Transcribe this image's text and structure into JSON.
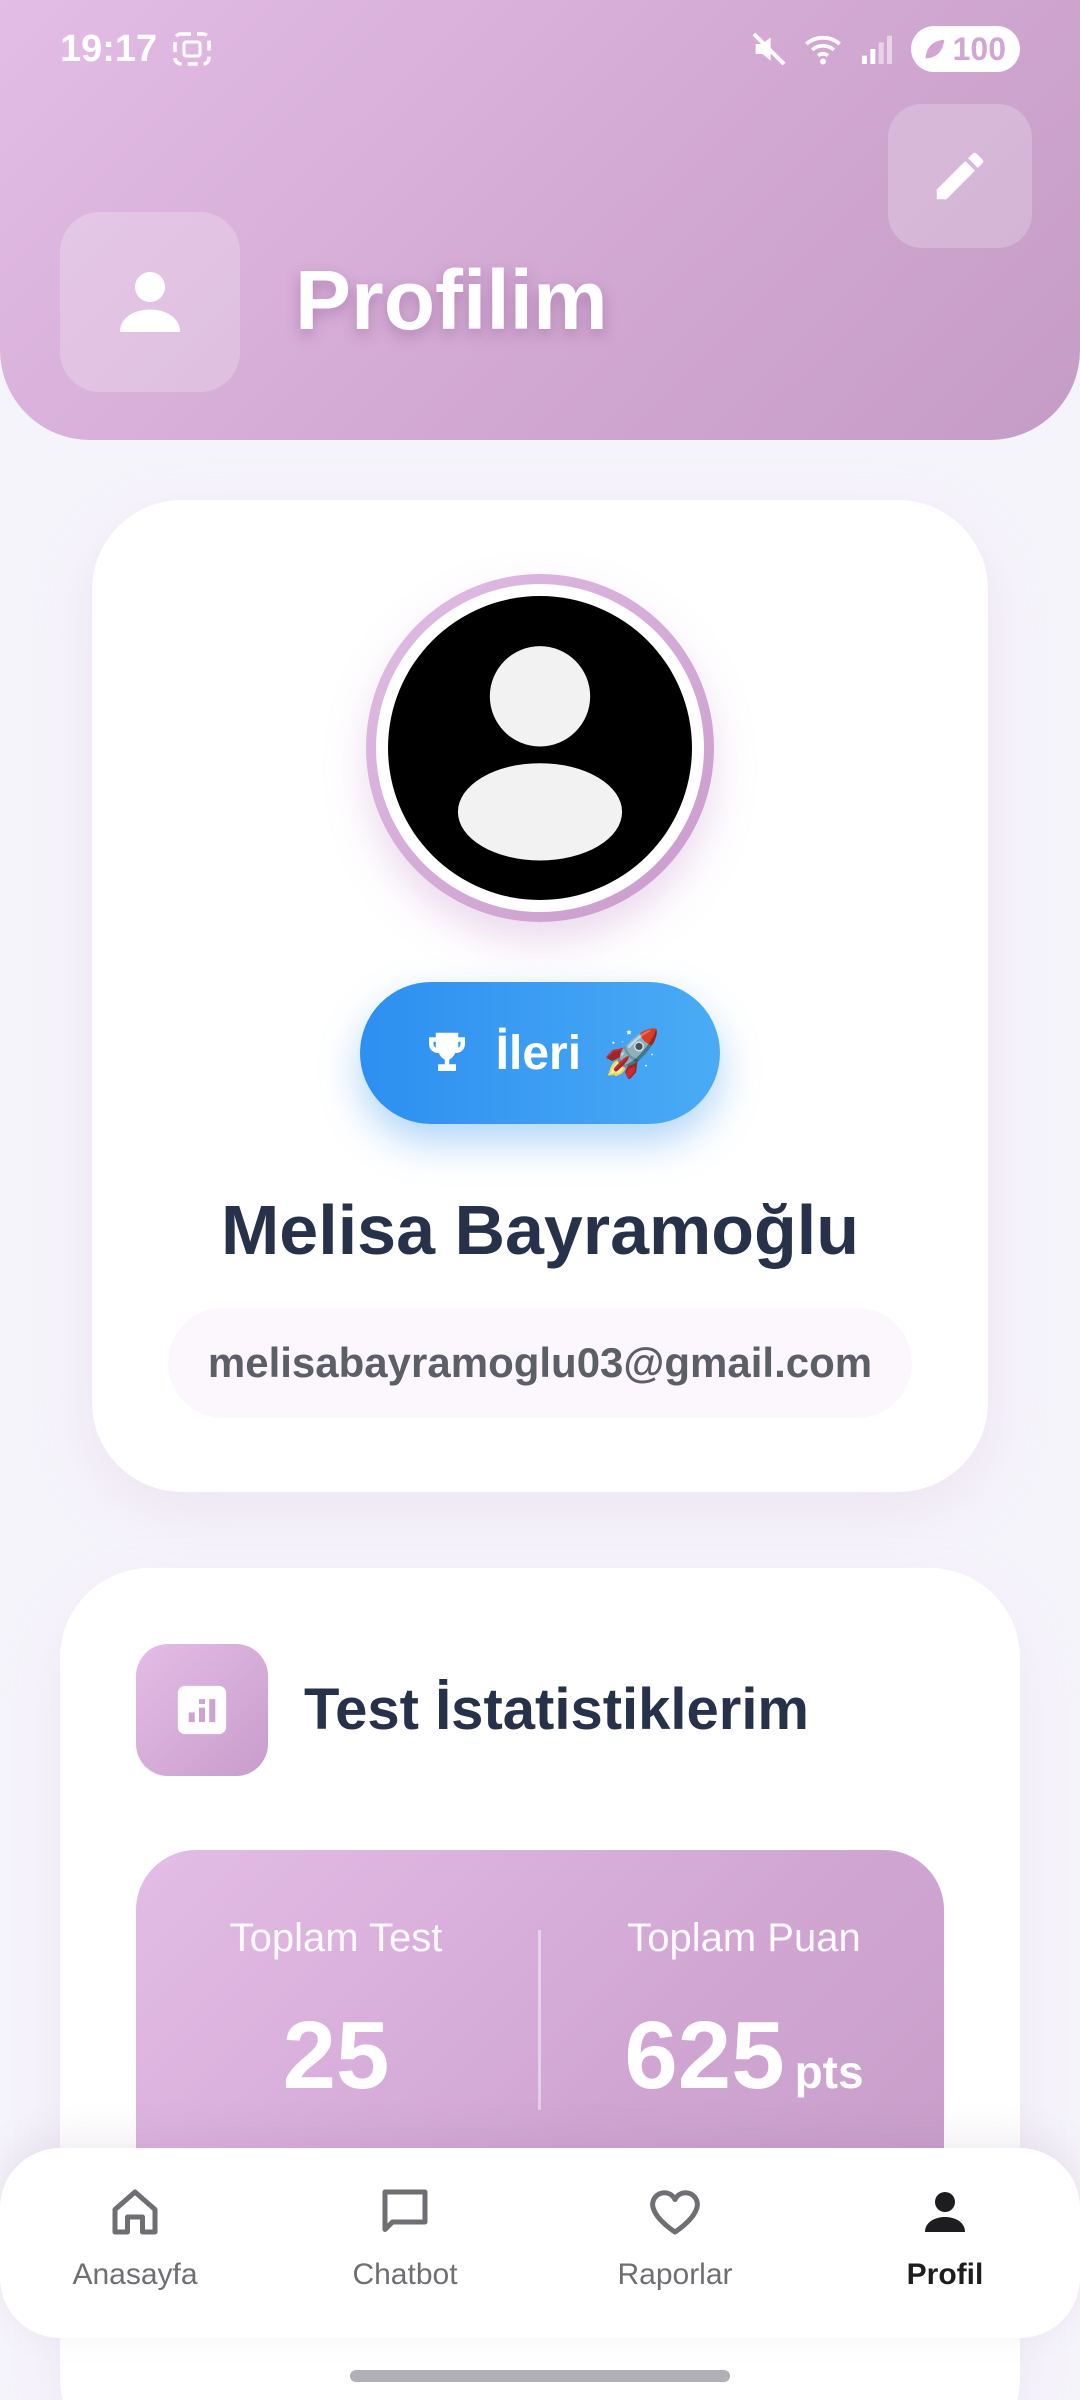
{
  "status_bar": {
    "time": "19:17",
    "battery": "100"
  },
  "header": {
    "title": "Profilim",
    "accent_gradient": [
      "#e3bde6",
      "#c59cc6"
    ]
  },
  "profile": {
    "level_label": "İleri",
    "level_emoji": "🚀",
    "name": "Melisa Bayramoğlu",
    "email": "melisabayramoglu03@gmail.com"
  },
  "stats": {
    "title": "Test İstatistiklerim",
    "total_tests_label": "Toplam Test",
    "total_tests_value": "25",
    "total_points_label": "Toplam Puan",
    "total_points_value": "625",
    "points_unit": "pts"
  },
  "nav": {
    "items": [
      {
        "label": "Anasayfa",
        "icon": "home-icon"
      },
      {
        "label": "Chatbot",
        "icon": "chat-icon"
      },
      {
        "label": "Raporlar",
        "icon": "heart-icon"
      },
      {
        "label": "Profil",
        "icon": "person-icon"
      }
    ],
    "active_index": 3
  },
  "colors": {
    "badge_blue": "#2d8ff0",
    "text_dark": "#27314a"
  }
}
